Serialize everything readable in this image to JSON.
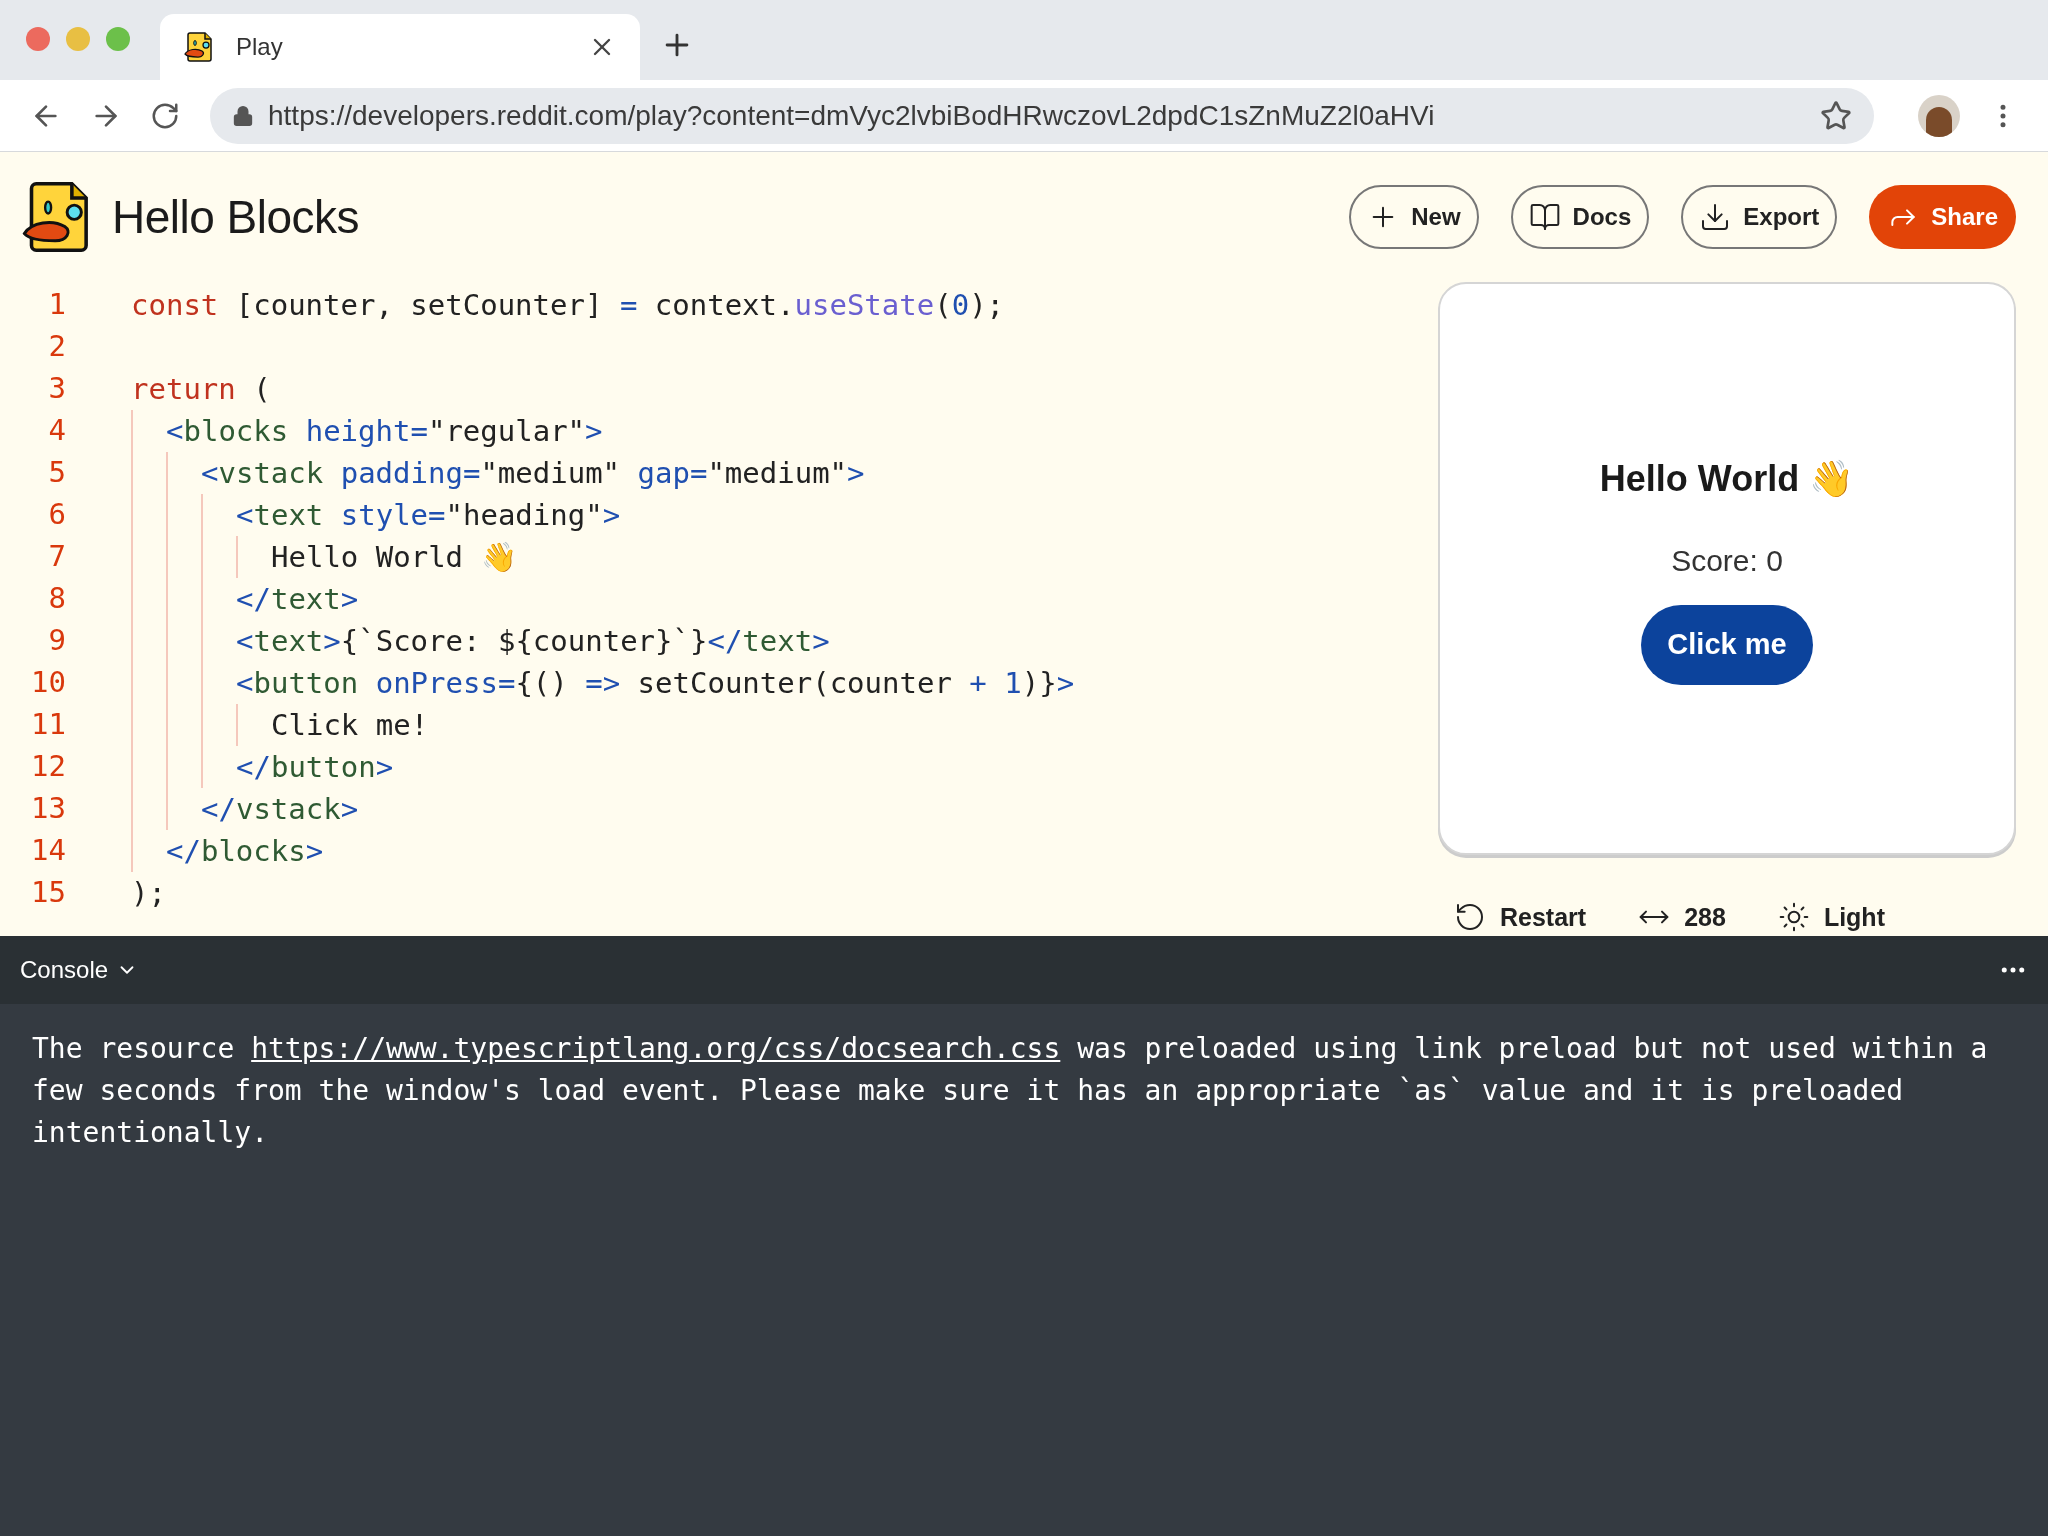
{
  "browser": {
    "tab": {
      "title": "Play"
    },
    "url": "https://developers.reddit.com/play?content=dmVyc2lvbiBodHRwczovL2dpdC1sZnMuZ2l0aHVi"
  },
  "header": {
    "title": "Hello Blocks",
    "buttons": [
      {
        "label": "New",
        "kind": "new"
      },
      {
        "label": "Docs",
        "kind": "docs"
      },
      {
        "label": "Export",
        "kind": "export"
      },
      {
        "label": "Share",
        "kind": "share"
      }
    ]
  },
  "code": [
    {
      "number": "1",
      "tokens": [
        {
          "text": "const",
          "kind": "keyword"
        },
        {
          "text": " [counter, setCounter] ",
          "kind": "plain"
        },
        {
          "text": "=",
          "kind": "op"
        },
        {
          "text": " context.",
          "kind": "plain"
        },
        {
          "text": "useState",
          "kind": "fn"
        },
        {
          "text": "(",
          "kind": "plain"
        },
        {
          "text": "0",
          "kind": "op"
        },
        {
          "text": ");",
          "kind": "plain"
        }
      ]
    },
    {
      "number": "2"
    },
    {
      "number": "3",
      "tokens": [
        {
          "text": "return",
          "kind": "keyword"
        },
        {
          "text": " (",
          "kind": "plain"
        }
      ],
      "children": [
        {
          "number": "4",
          "tokens": [
            {
              "text": "<",
              "kind": "op"
            },
            {
              "text": "blocks",
              "kind": "tag"
            },
            {
              "text": " height=",
              "kind": "op"
            },
            {
              "text": "\"regular\"",
              "kind": "plain"
            },
            {
              "text": ">",
              "kind": "op"
            }
          ],
          "children": [
            {
              "number": "5",
              "tokens": [
                {
                  "text": "<",
                  "kind": "op"
                },
                {
                  "text": "vstack",
                  "kind": "tag"
                },
                {
                  "text": " padding=",
                  "kind": "op"
                },
                {
                  "text": "\"medium\"",
                  "kind": "plain"
                },
                {
                  "text": " gap=",
                  "kind": "op"
                },
                {
                  "text": "\"medium\"",
                  "kind": "plain"
                },
                {
                  "text": ">",
                  "kind": "op"
                }
              ],
              "children": [
                {
                  "number": "6",
                  "tokens": [
                    {
                      "text": "<",
                      "kind": "op"
                    },
                    {
                      "text": "text",
                      "kind": "tag"
                    },
                    {
                      "text": " style=",
                      "kind": "op"
                    },
                    {
                      "text": "\"heading\"",
                      "kind": "plain"
                    },
                    {
                      "text": ">",
                      "kind": "op"
                    }
                  ],
                  "children": [
                    {
                      "number": "7",
                      "tokens": [
                        {
                          "text": "Hello World 👋",
                          "kind": "plain"
                        }
                      ]
                    }
                  ]
                },
                {
                  "number": "8",
                  "tokens": [
                    {
                      "text": "</",
                      "kind": "op"
                    },
                    {
                      "text": "text",
                      "kind": "tag"
                    },
                    {
                      "text": ">",
                      "kind": "op"
                    }
                  ]
                },
                {
                  "number": "9",
                  "tokens": [
                    {
                      "text": "<",
                      "kind": "op"
                    },
                    {
                      "text": "text",
                      "kind": "tag"
                    },
                    {
                      "text": ">",
                      "kind": "op"
                    },
                    {
                      "text": "{`Score: ${counter}`}",
                      "kind": "plain"
                    },
                    {
                      "text": "</",
                      "kind": "op"
                    },
                    {
                      "text": "text",
                      "kind": "tag"
                    },
                    {
                      "text": ">",
                      "kind": "op"
                    }
                  ]
                },
                {
                  "number": "10",
                  "tokens": [
                    {
                      "text": "<",
                      "kind": "op"
                    },
                    {
                      "text": "button",
                      "kind": "tag"
                    },
                    {
                      "text": " onPress=",
                      "kind": "op"
                    },
                    {
                      "text": "{() ",
                      "kind": "plain"
                    },
                    {
                      "text": "=>",
                      "kind": "op"
                    },
                    {
                      "text": " setCounter(counter ",
                      "kind": "plain"
                    },
                    {
                      "text": "+ 1",
                      "kind": "op"
                    },
                    {
                      "text": ")}",
                      "kind": "plain"
                    },
                    {
                      "text": ">",
                      "kind": "op"
                    }
                  ],
                  "children": [
                    {
                      "number": "11",
                      "tokens": [
                        {
                          "text": "Click me!",
                          "kind": "plain"
                        }
                      ]
                    }
                  ]
                },
                {
                  "number": "12",
                  "tokens": [
                    {
                      "text": "</",
                      "kind": "op"
                    },
                    {
                      "text": "button",
                      "kind": "tag"
                    },
                    {
                      "text": ">",
                      "kind": "op"
                    }
                  ]
                }
              ]
            },
            {
              "number": "13",
              "tokens": [
                {
                  "text": "</",
                  "kind": "op"
                },
                {
                  "text": "vstack",
                  "kind": "tag"
                },
                {
                  "text": ">",
                  "kind": "op"
                }
              ]
            }
          ]
        },
        {
          "number": "14",
          "tokens": [
            {
              "text": "</",
              "kind": "op"
            },
            {
              "text": "blocks",
              "kind": "tag"
            },
            {
              "text": ">",
              "kind": "op"
            }
          ]
        }
      ]
    },
    {
      "number": "15",
      "tokens": [
        {
          "text": ");",
          "kind": "plain"
        }
      ]
    }
  ],
  "preview": {
    "heading": "Hello World 👋",
    "score": "Score: 0",
    "button": "Click me"
  },
  "preview_controls": [
    {
      "label": "Restart",
      "kind": "restart"
    },
    {
      "label": "288",
      "kind": "width"
    },
    {
      "label": "Light",
      "kind": "theme"
    }
  ],
  "console": {
    "title": "Console",
    "message": {
      "before": "The resource ",
      "link": "https://www.typescriptlang.org/css/docsearch.css",
      "after": " was preloaded using link preload but not used within a few seconds from the window's load event. Please make sure it has an appropriate `as` value and it is preloaded intentionally."
    }
  }
}
